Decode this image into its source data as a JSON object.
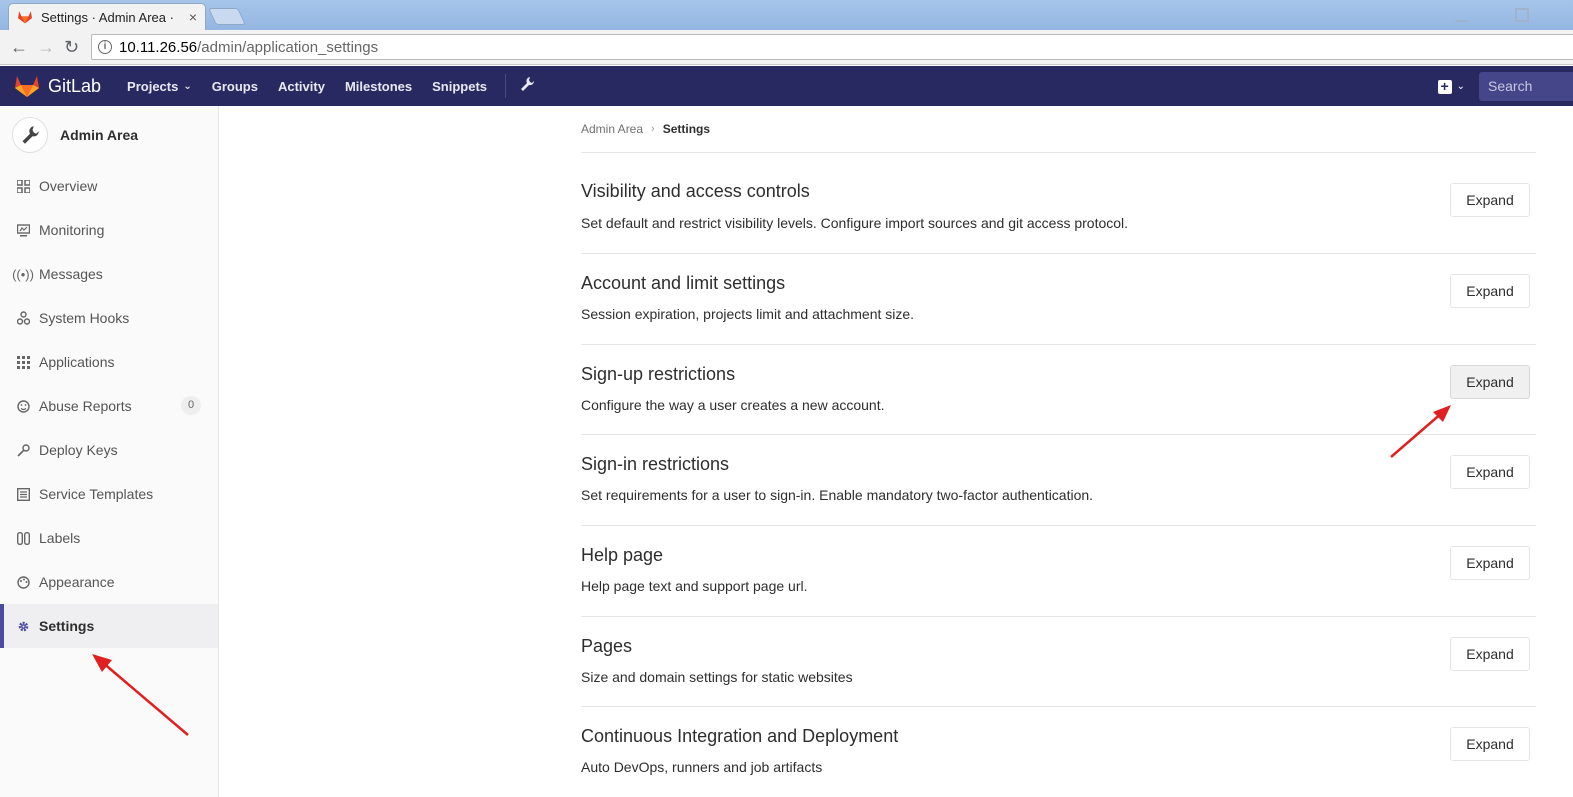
{
  "browser": {
    "tab_title": "Settings · Admin Area · ",
    "tab_close": "×",
    "url_host": "10.11.26.56",
    "url_path": "/admin/application_settings",
    "back": "←",
    "forward": "→",
    "reload": "↻"
  },
  "header": {
    "brand": "GitLab",
    "nav": [
      {
        "label": "Projects",
        "dropdown": true
      },
      {
        "label": "Groups"
      },
      {
        "label": "Activity"
      },
      {
        "label": "Milestones"
      },
      {
        "label": "Snippets"
      }
    ],
    "search_placeholder": "Search",
    "colors": {
      "header_bg": "#292961",
      "active_accent": "#4b4ba3"
    }
  },
  "sidebar": {
    "title": "Admin Area",
    "items": [
      {
        "label": "Overview",
        "icon": "grid-icon"
      },
      {
        "label": "Monitoring",
        "icon": "monitor-icon"
      },
      {
        "label": "Messages",
        "icon": "broadcast-icon"
      },
      {
        "label": "System Hooks",
        "icon": "hook-icon"
      },
      {
        "label": "Applications",
        "icon": "apps-icon"
      },
      {
        "label": "Abuse Reports",
        "icon": "smiley-icon",
        "badge": "0"
      },
      {
        "label": "Deploy Keys",
        "icon": "key-icon"
      },
      {
        "label": "Service Templates",
        "icon": "template-icon"
      },
      {
        "label": "Labels",
        "icon": "label-icon"
      },
      {
        "label": "Appearance",
        "icon": "palette-icon"
      },
      {
        "label": "Settings",
        "icon": "gear-icon",
        "active": true
      }
    ]
  },
  "breadcrumb": {
    "parent": "Admin Area",
    "separator": "›",
    "current": "Settings"
  },
  "sections": [
    {
      "title": "Visibility and access controls",
      "description": "Set default and restrict visibility levels. Configure import sources and git access protocol.",
      "button": "Expand"
    },
    {
      "title": "Account and limit settings",
      "description": "Session expiration, projects limit and attachment size.",
      "button": "Expand"
    },
    {
      "title": "Sign-up restrictions",
      "description": "Configure the way a user creates a new account.",
      "button": "Expand",
      "hover": true
    },
    {
      "title": "Sign-in restrictions",
      "description": "Set requirements for a user to sign-in. Enable mandatory two-factor authentication.",
      "button": "Expand"
    },
    {
      "title": "Help page",
      "description": "Help page text and support page url.",
      "button": "Expand"
    },
    {
      "title": "Pages",
      "description": "Size and domain settings for static websites",
      "button": "Expand"
    },
    {
      "title": "Continuous Integration and Deployment",
      "description": "Auto DevOps, runners and job artifacts",
      "button": "Expand"
    }
  ]
}
